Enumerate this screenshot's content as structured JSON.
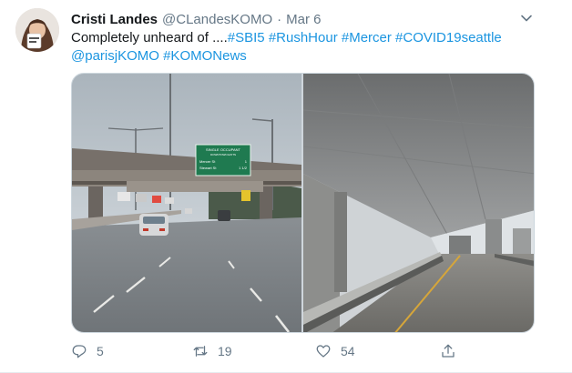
{
  "tweet": {
    "author_name": "Cristi Landes",
    "handle": "@CLandesKOMO",
    "separator": "·",
    "time": "Mar 6",
    "text_prefix": "Completely unheard of ....",
    "line1_tags": [
      "#SBI5",
      "#RushHour",
      "#Mercer",
      "#COVID19seattle"
    ],
    "line2_tags": [
      "@parisjKOMO",
      "#KOMONews"
    ]
  },
  "media": {
    "sign": {
      "line1": "SINGLE OCCUPANT",
      "line2": "DOWNTOWN EXITS",
      "exit1": "Mercer St",
      "exit2": "Stewart St",
      "exit1_dist": "1",
      "exit2_dist": "1 1/2"
    }
  },
  "actions": {
    "replies": "5",
    "retweets": "19",
    "likes": "54"
  },
  "icons": {
    "caret": "chevron-down-icon",
    "reply": "reply-icon",
    "retweet": "retweet-icon",
    "like": "heart-icon",
    "share": "share-icon"
  },
  "colors": {
    "link": "#1b95e0",
    "muted": "#657786",
    "text": "#14171a",
    "sign": "#1f7a50"
  }
}
